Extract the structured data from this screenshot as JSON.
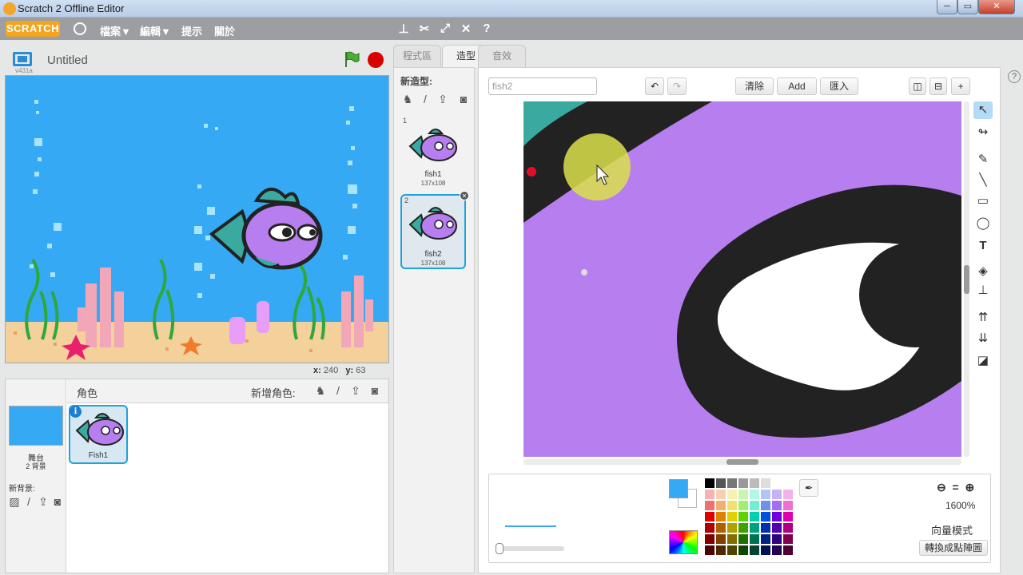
{
  "window": {
    "title": "Scratch 2 Offline Editor",
    "min": "─",
    "max": "▭",
    "close": "✕"
  },
  "menubar": {
    "logo": "SCRATCH",
    "items": [
      "檔案▼",
      "編輯▼",
      "提示",
      "關於"
    ],
    "tools": [
      "stamp-icon",
      "shrink-icon",
      "grow-icon",
      "shrink-icon",
      "help-icon"
    ]
  },
  "stage": {
    "version": "v431a",
    "title": "Untitled",
    "coords": {
      "x_label": "x:",
      "x": "240",
      "y_label": "y:",
      "y": "63"
    }
  },
  "sprites": {
    "title": "角色",
    "new_sprite_label": "新增角色:",
    "stage_label": "舞台",
    "stage_bg_count": "2 背景",
    "new_backdrop_label": "新背景:",
    "items": [
      {
        "name": "Fish1",
        "info": "i"
      }
    ]
  },
  "tabs": [
    {
      "label": "程式區",
      "active": false
    },
    {
      "label": "造型",
      "active": true
    },
    {
      "label": "音效",
      "active": false
    }
  ],
  "costumes": {
    "new_label": "新造型:",
    "items": [
      {
        "num": "1",
        "name": "fish1",
        "size": "137x108",
        "selected": false
      },
      {
        "num": "2",
        "name": "fish2",
        "size": "137x108",
        "selected": true
      }
    ]
  },
  "editor": {
    "costume_name": "fish2",
    "clear_label": "清除",
    "add_label": "Add",
    "import_label": "匯入",
    "zoom_level": "1600%",
    "mode_label": "向量模式",
    "convert_label": "轉換成點陣圖",
    "primary_color": "#36a9f5",
    "canvas_color": "#b77ef0",
    "help": "?"
  },
  "palette": [
    "#000000",
    "#555555",
    "#777777",
    "#999999",
    "#bbbbbb",
    "#dddddd",
    "#ffffff",
    "#ffffff",
    "#f6b1b1",
    "#f6d0b1",
    "#f6f0b1",
    "#c8f6b1",
    "#b1f6e6",
    "#b1c6f6",
    "#c8b1f6",
    "#f6b1e8",
    "#f07070",
    "#f0b070",
    "#f0e070",
    "#a0f070",
    "#70f0d0",
    "#7090f0",
    "#a070f0",
    "#f070d0",
    "#e00000",
    "#e08000",
    "#e0d000",
    "#60d000",
    "#00d0b0",
    "#0050e0",
    "#7000e0",
    "#e000b0",
    "#b00000",
    "#b06000",
    "#b0a000",
    "#40a000",
    "#00a080",
    "#0030b0",
    "#5000b0",
    "#b00080",
    "#800000",
    "#804000",
    "#807000",
    "#207000",
    "#007050",
    "#002080",
    "#300080",
    "#800050",
    "#500000",
    "#502800",
    "#504500",
    "#104500",
    "#004530",
    "#001050",
    "#200050",
    "#500030"
  ]
}
